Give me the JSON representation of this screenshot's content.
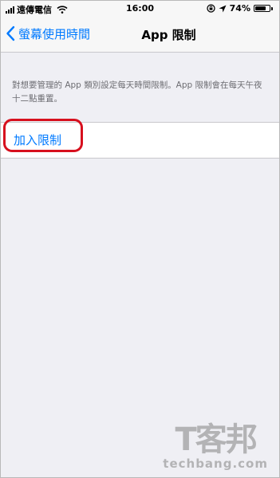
{
  "status_bar": {
    "carrier": "遠傳電信",
    "time": "16:00",
    "battery": "74%",
    "battery_level": 0.74,
    "icons": [
      "signal-icon",
      "wifi-icon",
      "rotation-lock-icon",
      "location-icon",
      "battery-icon"
    ]
  },
  "nav": {
    "back_label": "螢幕使用時間",
    "title": "App 限制"
  },
  "footer_text": "對想要管理的 App 類別設定每天時間限制。App 限制會在每天午夜十二點重置。",
  "actions": {
    "add_limit_label": "加入限制"
  },
  "colors": {
    "accent": "#007aff",
    "highlight": "#d7101e",
    "background": "#efeff4"
  },
  "watermark": {
    "mark": "T客邦",
    "text": "techbang.com"
  }
}
